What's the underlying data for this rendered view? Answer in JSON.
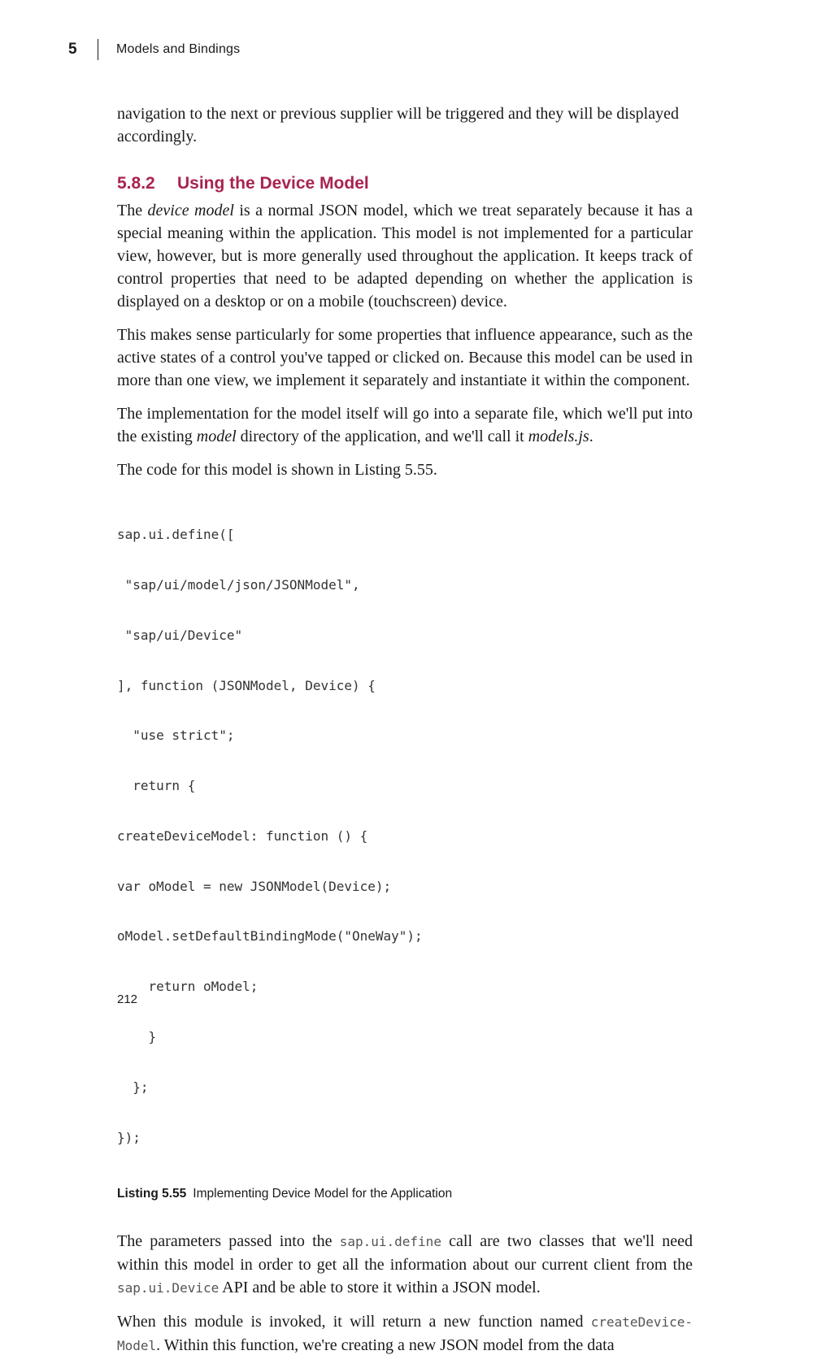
{
  "header": {
    "chapter_number": "5",
    "chapter_title": "Models and Bindings"
  },
  "intro": {
    "text": "navigation to the next or previous supplier will be triggered and they will be displayed accordingly."
  },
  "section": {
    "number": "5.8.2",
    "title": "Using the Device Model"
  },
  "paragraphs": {
    "p1": {
      "before": "The ",
      "em": "device model",
      "after": " is a normal JSON model, which we treat separately because it has a special meaning within the application. This model is not implemented for a particular view, however, but is more generally used throughout the application. It keeps track of control properties that need to be adapted depending on whether the application is displayed on a desktop or on a mobile (touchscreen) device."
    },
    "p2": "This makes sense particularly for some properties that influence appearance, such as the active states of a control you've tapped or clicked on. Because this model can be used in more than one view, we implement it separately and instantiate it within the component.",
    "p3": {
      "a": "The implementation for the model itself will go into a separate file, which we'll put into the existing ",
      "em1": "model",
      "b": " directory of the application, and we'll call it ",
      "em2": "models.js",
      "c": "."
    },
    "p4": "The code for this model is shown in Listing 5.55."
  },
  "code_lines": [
    "sap.ui.define([",
    " \"sap/ui/model/json/JSONModel\",",
    " \"sap/ui/Device\"",
    "], function (JSONModel, Device) {",
    "  \"use strict\";",
    "  return {",
    "createDeviceModel: function () {",
    "var oModel = new JSONModel(Device);",
    "oModel.setDefaultBindingMode(\"OneWay\");",
    "    return oModel;",
    "    }",
    "  };",
    "});"
  ],
  "listing": {
    "label": "Listing 5.55",
    "caption": "Implementing Device Model for the Application"
  },
  "p5": {
    "a": "The parameters passed into the ",
    "code1": "sap.ui.define",
    "b": " call are two classes that we'll need within this model in order to get all the information about our current client from the ",
    "code2": "sap.ui.Device",
    "c": " API and be able to store it within a JSON model."
  },
  "p6": {
    "a": "When this module is invoked, it will return a new function named ",
    "code1a": "createDevice-",
    "code1b": "Model",
    "b": ". Within this function, we're creating a new JSON model from the data"
  },
  "footer": {
    "page_number": "212"
  }
}
